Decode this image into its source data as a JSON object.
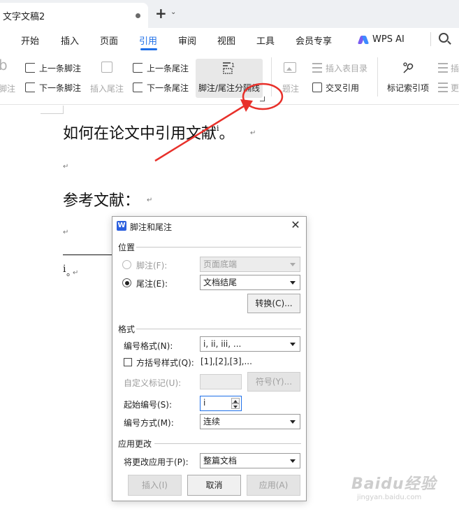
{
  "window": {
    "tab_title": "文字文稿2",
    "new_tab": "+",
    "tab_dropdown": "⌄"
  },
  "menu": {
    "items": [
      "开始",
      "插入",
      "页面",
      "引用",
      "审阅",
      "视图",
      "工具",
      "会员专享"
    ],
    "active": "引用",
    "wps_ai": "WPS AI"
  },
  "ribbon": {
    "partial_left": "脚注",
    "prev_footnote": "上一条脚注",
    "next_footnote": "下一条脚注",
    "insert_endnote": "插入尾注",
    "prev_endnote": "上一条尾注",
    "next_endnote": "下一条尾注",
    "separator_btn": "脚注/尾注分隔线",
    "caption": "题注",
    "insert_toc_table": "插入表目录",
    "cross_ref": "交叉引用",
    "mark_index": "标记索引项",
    "partial_right_top": "插",
    "partial_right_bottom": "更"
  },
  "document": {
    "heading": "如何在论文中引用文献",
    "heading_sup": "i",
    "heading_end": "。",
    "ref_heading": "参考文献：",
    "endnote_mark": "i",
    "endnote_dot": "。",
    "para_mark": "↵"
  },
  "dialog": {
    "title": "脚注和尾注",
    "logo": "W",
    "close": "✕",
    "position_group": "位置",
    "footnote_label": "脚注(F):",
    "footnote_value": "页面底端",
    "endnote_label": "尾注(E):",
    "endnote_value": "文档结尾",
    "convert_btn": "转换(C)...",
    "format_group": "格式",
    "number_format_label": "编号格式(N):",
    "number_format_value": "i, ii, iii, ...",
    "bracket_label": "方括号样式(Q):",
    "bracket_example": "[1],[2],[3],...",
    "custom_mark_label": "自定义标记(U):",
    "symbol_btn": "符号(Y)...",
    "start_at_label": "起始编号(S):",
    "start_at_value": "i",
    "numbering_label": "编号方式(M):",
    "numbering_value": "连续",
    "apply_group": "应用更改",
    "apply_to_label": "将更改应用于(P):",
    "apply_to_value": "整篇文档",
    "insert_btn": "插入(I)",
    "cancel_btn": "取消",
    "apply_btn": "应用(A)"
  },
  "watermark": {
    "main": "Baidu经验",
    "sub": "jingyan.baidu.com"
  },
  "colors": {
    "accent": "#1e6fe8",
    "annotation": "#e8302a"
  }
}
